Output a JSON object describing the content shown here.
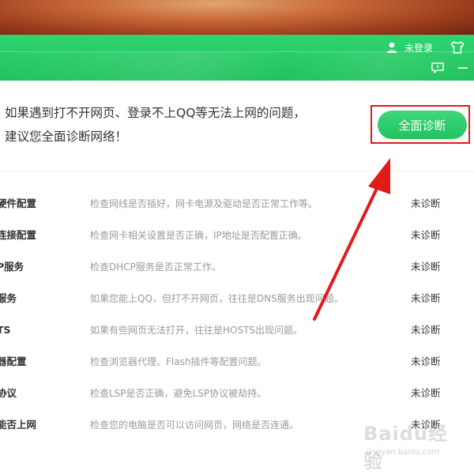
{
  "header": {
    "user_label": "未登录"
  },
  "hero": {
    "line1": "如果遇到打不开网页、登录不上QQ等无法上网的问题，",
    "line2": "建议您全面诊断网络！",
    "diagnose_button": "全面诊断"
  },
  "items": [
    {
      "name": "硬件配置",
      "desc": "检查网线是否插好，网卡电源及驱动是否正常工作等。",
      "status": "未诊断"
    },
    {
      "name": "连接配置",
      "desc": "检查网卡相关设置是否正确，IP地址是否配置正确。",
      "status": "未诊断"
    },
    {
      "name": "P服务",
      "desc": "检查DHCP服务是否正常工作。",
      "status": "未诊断"
    },
    {
      "name": "服务",
      "desc": "如果您能上QQ，但打不开网页，往往是DNS服务出现问题。",
      "status": "未诊断"
    },
    {
      "name": "TS",
      "desc": "如果有些网页无法打开，往往是HOSTS出现问题。",
      "status": "未诊断"
    },
    {
      "name": "器配置",
      "desc": "检查浏览器代理、Flash插件等配置问题。",
      "status": "未诊断"
    },
    {
      "name": "协议",
      "desc": "检查LSP是否正确，避免LSP协议被劫持。",
      "status": "未诊断"
    },
    {
      "name": "能否上网",
      "desc": "检查您的电脑是否可以访问网页，网络是否连通。",
      "status": "未诊断"
    }
  ],
  "watermark": {
    "brand": "Baidu经验",
    "url": "jingyan.baidu.com"
  },
  "colors": {
    "accent_green": "#22c25e",
    "highlight_red": "#e11a1a"
  },
  "icons": [
    "user-icon",
    "shirt-icon",
    "feedback-icon",
    "minimize-icon",
    "arrow-annotation"
  ]
}
